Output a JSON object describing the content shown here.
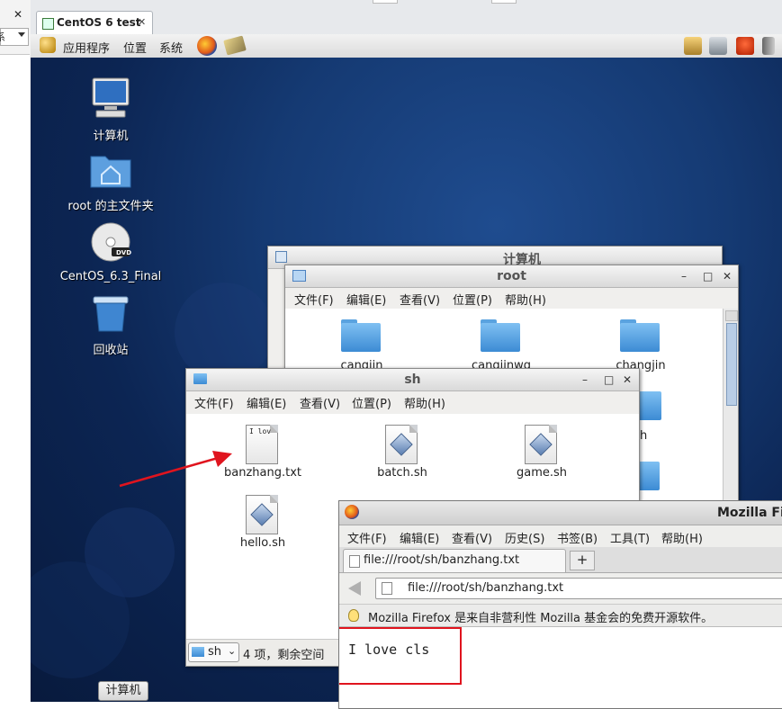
{
  "host": {
    "tab_title": "CentOS 6 test",
    "tab_close": "✕",
    "left_close": "✕",
    "left_combo": "系",
    "taskbar_button": "计算机"
  },
  "guest_panel": {
    "menu_apps": "应用程序",
    "menu_places": "位置",
    "menu_system": "系统"
  },
  "desktop_icons": [
    {
      "label": "计算机",
      "icon": "computer-icon"
    },
    {
      "label": "root 的主文件夹",
      "icon": "home-folder-icon"
    },
    {
      "label": "CentOS_6.3_Final",
      "icon": "dvd-icon",
      "badge": "DVD"
    },
    {
      "label": "回收站",
      "icon": "trash-icon"
    }
  ],
  "win_root": {
    "title": "root",
    "back_title": "计算机",
    "menu": [
      "文件(F)",
      "编辑(E)",
      "查看(V)",
      "位置(P)",
      "帮助(H)"
    ],
    "folders": [
      "cangjin",
      "cangjinwg",
      "changjin"
    ],
    "partial_label": "h",
    "controls": {
      "minimize": "–",
      "maximize": "□",
      "close": "✕"
    }
  },
  "win_sh": {
    "title": "sh",
    "menu": [
      "文件(F)",
      "编辑(E)",
      "查看(V)",
      "位置(P)",
      "帮助(H)"
    ],
    "files": [
      {
        "name": "banzhang.txt",
        "preview": "I lov",
        "type": "text"
      },
      {
        "name": "batch.sh",
        "type": "script"
      },
      {
        "name": "game.sh",
        "type": "script"
      },
      {
        "name": "hello.sh",
        "type": "script"
      }
    ],
    "status_path": "sh",
    "status_text": "4 项，剩余空间",
    "controls": {
      "minimize": "–",
      "maximize": "□",
      "close": "✕"
    }
  },
  "firefox": {
    "title": "Mozilla Fi",
    "menu": [
      "文件(F)",
      "编辑(E)",
      "查看(V)",
      "历史(S)",
      "书签(B)",
      "工具(T)",
      "帮助(H)"
    ],
    "tab_label": "file:///root/sh/banzhang.txt",
    "new_tab": "+",
    "url": "file:///root/sh/banzhang.txt",
    "notice": "Mozilla Firefox 是来自非营利性 Mozilla 基金会的免费开源软件。",
    "content": "I love cls"
  },
  "colors": {
    "annotation_red": "#e0141e",
    "desktop_blue": "#153a73"
  }
}
